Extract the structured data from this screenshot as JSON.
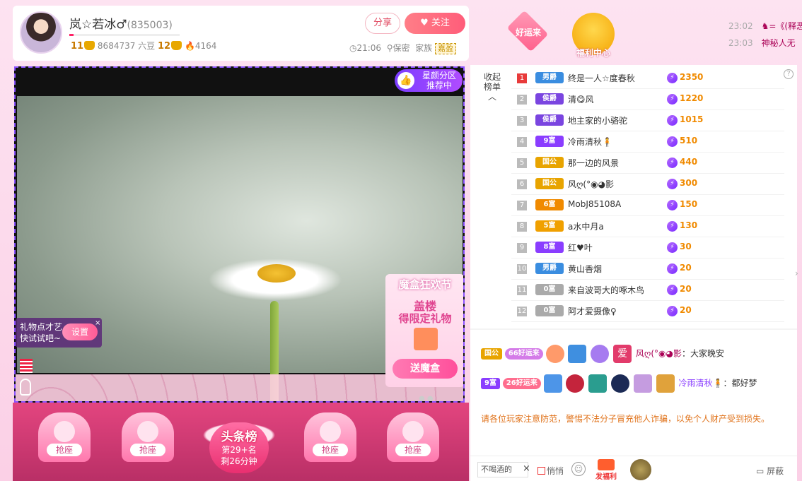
{
  "header": {
    "anchor_name": "岚☆若冰♂",
    "anchor_id": "(835003)",
    "level_left": "11",
    "beans": "8684737 六豆",
    "level_right": "12",
    "heat": "4164",
    "share_label": "分享",
    "follow_label": "关注",
    "time": "21:06",
    "location": "保密",
    "family_label": "家族",
    "family_tag": "嘉盈"
  },
  "badges": {
    "lucky": "好运来",
    "welfare": "福利中心"
  },
  "top_messages": [
    {
      "time": "23:02",
      "text": "♞=《(释恶"
    },
    {
      "time": "23:03",
      "text": "神秘人无"
    }
  ],
  "video": {
    "recommend_line1": "星颜分区",
    "recommend_line2": "推荐中",
    "box_title": "魔盒狂欢节",
    "box_line1": "盖楼",
    "box_line2": "得限定礼物",
    "box_button": "送魔盒",
    "gift_tip_line1": "礼物点才艺",
    "gift_tip_line2": "快试试吧~",
    "gift_tip_button": "设置",
    "gift_tip_close": "×",
    "pager": "● ●"
  },
  "seats": {
    "seat_label": "抢座",
    "toplist_title": "头条榜",
    "toplist_rank": "第29+名",
    "toplist_left": "剩26分钟"
  },
  "ranking": {
    "collapse_line1": "收起",
    "collapse_line2": "榜单",
    "help": "?",
    "rows": [
      {
        "rank": "1",
        "badge": "男爵",
        "name": "终是一人☆度春秋",
        "score": "2350"
      },
      {
        "rank": "2",
        "badge": "侯爵",
        "name": "清😋风",
        "score": "1220"
      },
      {
        "rank": "3",
        "badge": "侯爵",
        "name": "地主家的小骆驼",
        "score": "1015"
      },
      {
        "rank": "4",
        "badge": "9富",
        "name": "冷雨清秋🧍",
        "score": "510"
      },
      {
        "rank": "5",
        "badge": "国公",
        "name": "那一边的风景",
        "score": "440"
      },
      {
        "rank": "6",
        "badge": "国公",
        "name": "风ღ(°◉◕影",
        "score": "300"
      },
      {
        "rank": "7",
        "badge": "6富",
        "name": "MobJ85108A",
        "score": "150"
      },
      {
        "rank": "8",
        "badge": "5富",
        "name": "a水中月a",
        "score": "130"
      },
      {
        "rank": "9",
        "badge": "8富",
        "name": "红♥叶",
        "score": "30"
      },
      {
        "rank": "10",
        "badge": "男爵",
        "name": "黄山香烟",
        "score": "20"
      },
      {
        "rank": "11",
        "badge": "0富",
        "name": "来自波哥大的啄木鸟",
        "score": "20"
      },
      {
        "rank": "12",
        "badge": "0富",
        "name": "阿才爱摄像♀",
        "score": "20"
      }
    ]
  },
  "chat": {
    "msg1": {
      "tag": "国公",
      "lucky": "66好运来",
      "icon": "爱",
      "nick": "风ღ(°◉◕影",
      "text": "：大家晚安"
    },
    "msg2": {
      "tag": "9富",
      "lucky": "26好运来",
      "nick": "冷雨清秋🧍",
      "text": "：都好梦"
    },
    "notice": "请各位玩家注意防范，警惕不法分子冒充他人诈骗，以免个人财产受到损失。",
    "input_value": "不喝酒的",
    "quiet_label": "悄悄",
    "welfare_label": "发福利",
    "block_label": "屏蔽"
  },
  "colors": {
    "accent": "#ff5d7a",
    "purple": "#8b53ff",
    "score": "#f08a00"
  }
}
